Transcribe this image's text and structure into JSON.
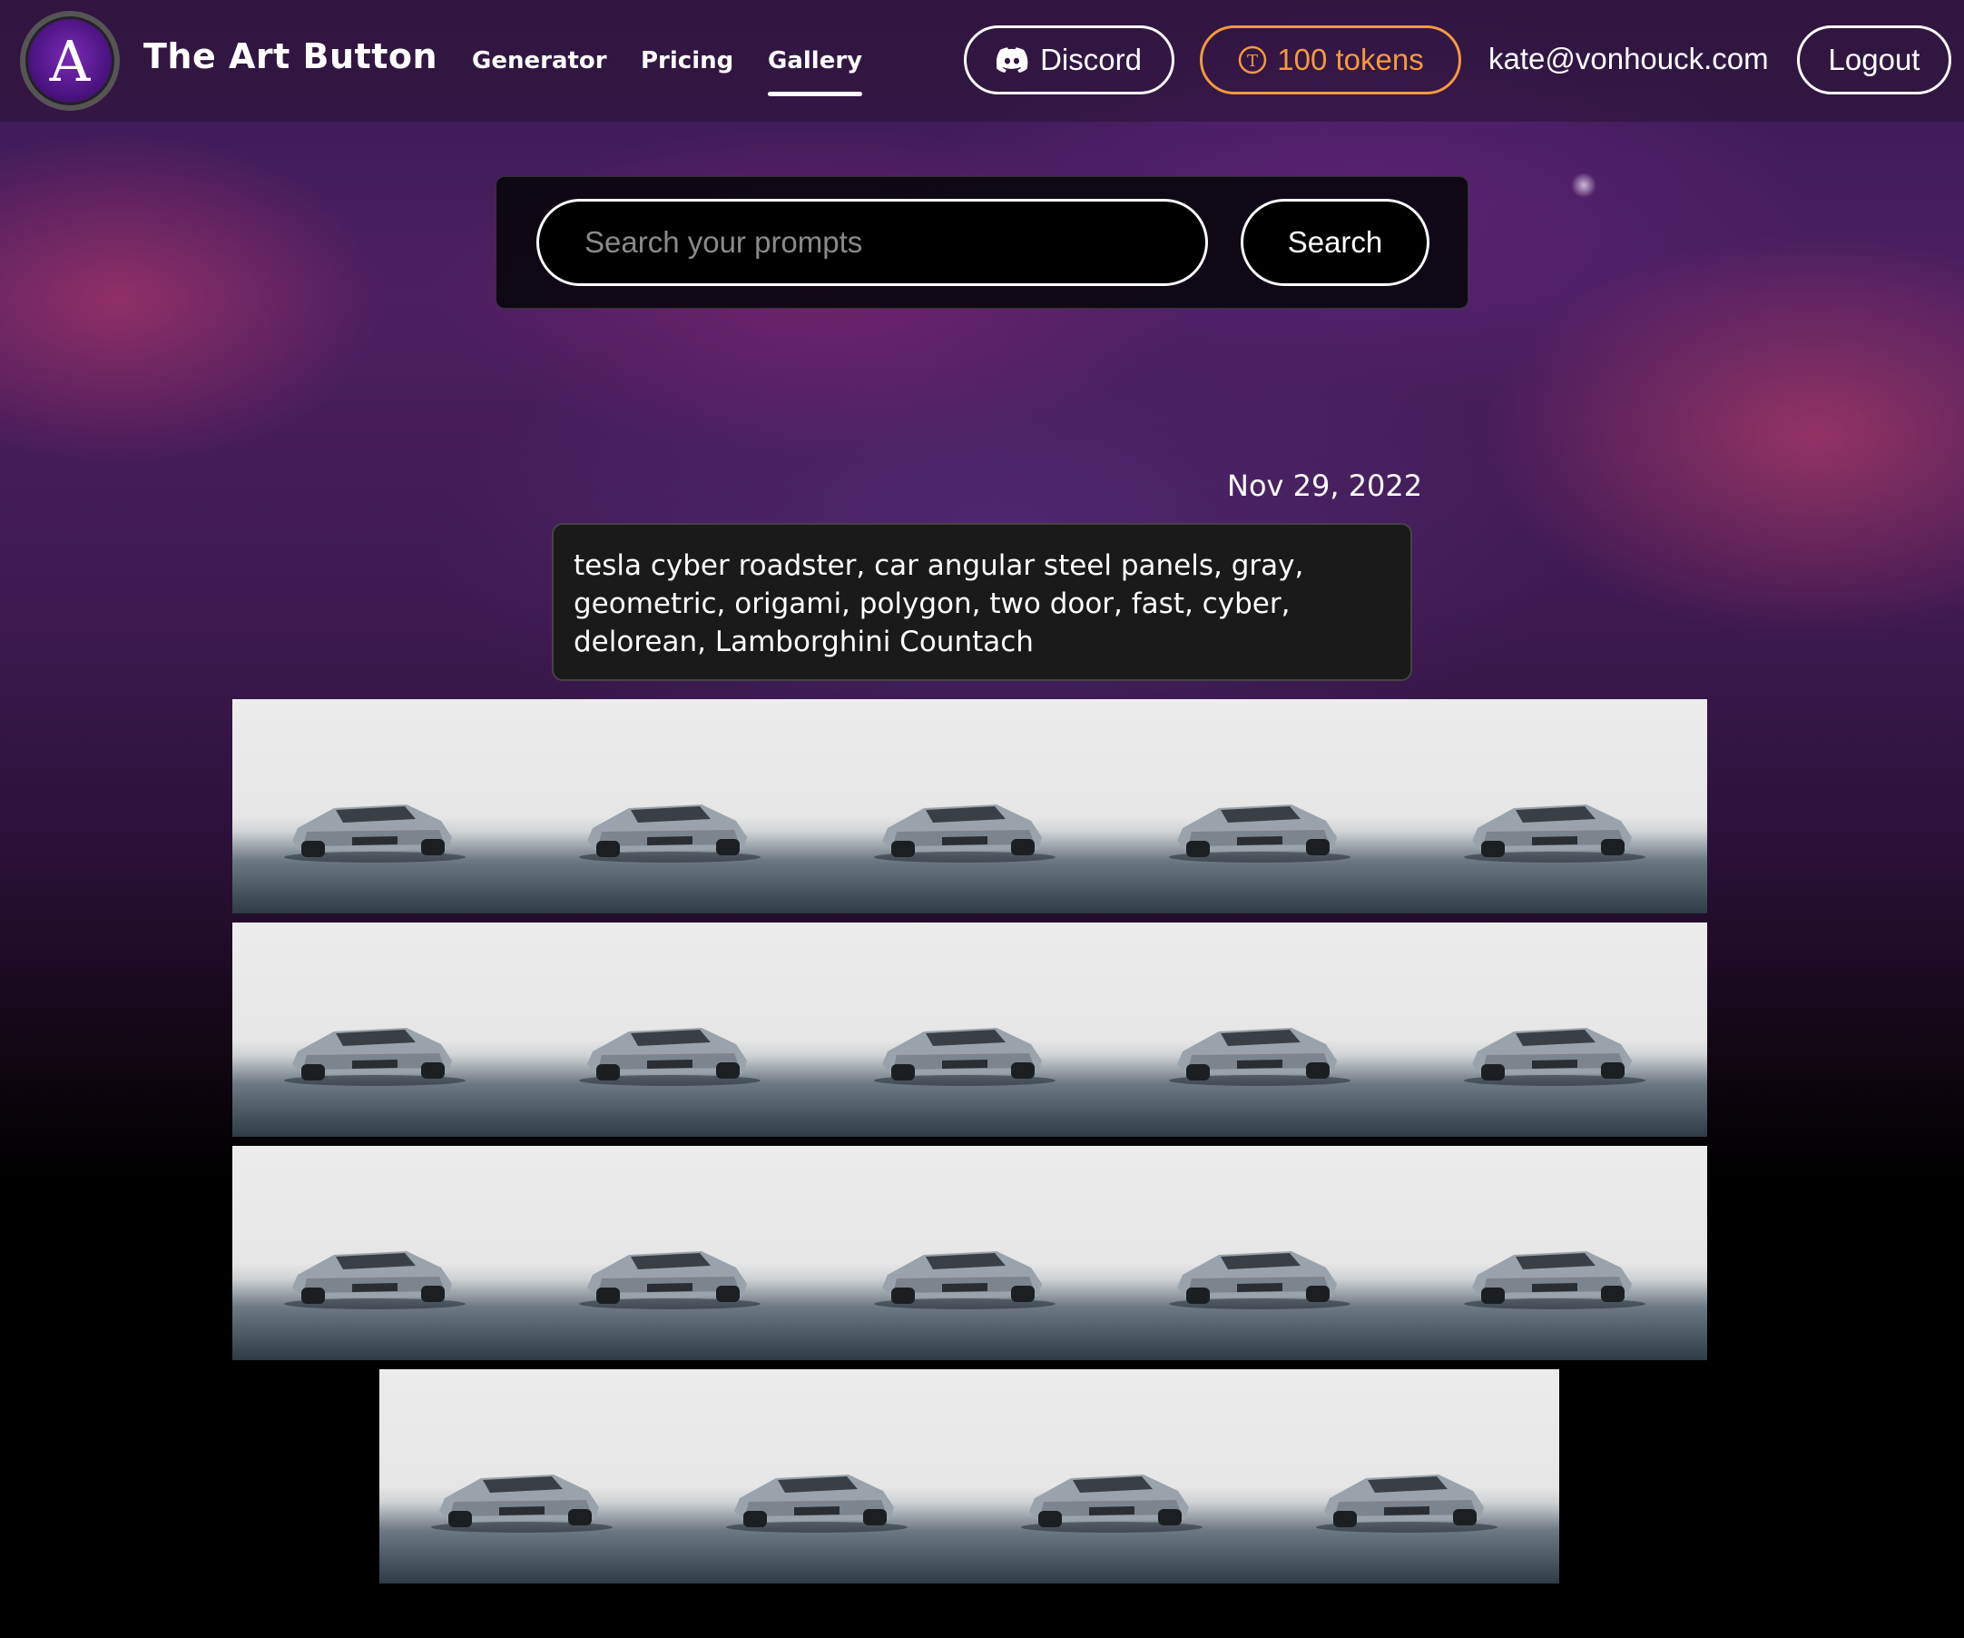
{
  "brand": {
    "logo_letter": "A",
    "name": "The Art Button"
  },
  "nav": [
    {
      "label": "Generator",
      "active": false
    },
    {
      "label": "Pricing",
      "active": false
    },
    {
      "label": "Gallery",
      "active": true
    }
  ],
  "header": {
    "discord_label": "Discord",
    "tokens_label": "100 tokens",
    "email": "kate@vonhouck.com",
    "logout_label": "Logout"
  },
  "search": {
    "placeholder": "Search your prompts",
    "button_label": "Search"
  },
  "entry": {
    "date": "Nov 29, 2022",
    "prompt": "tesla cyber roadster, car angular steel panels, gray, geometric, origami, polygon, two door, fast, cyber, delorean, Lamborghini Countach",
    "image_count": 19
  },
  "colors": {
    "token_accent": "#f39a3c",
    "background": "#000000"
  }
}
